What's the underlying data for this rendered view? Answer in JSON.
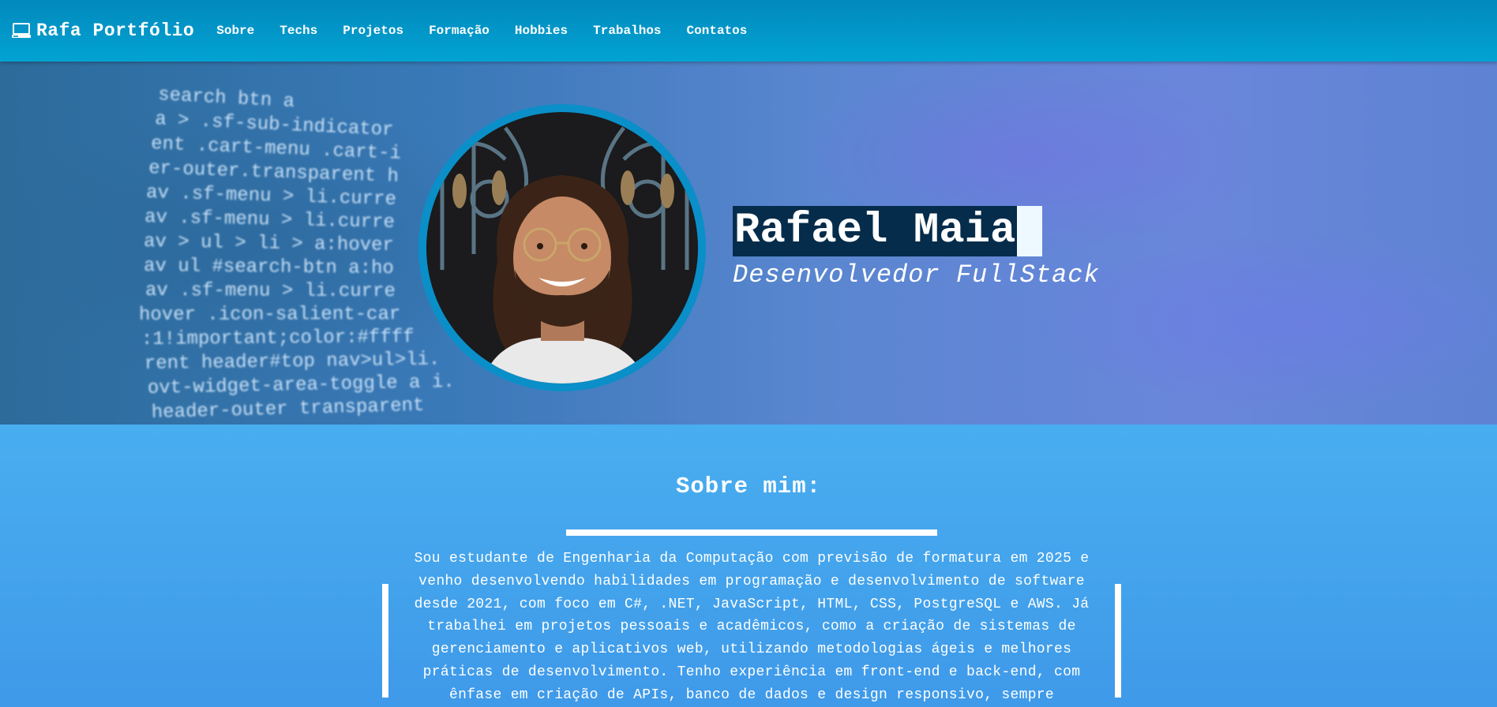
{
  "navbar": {
    "brand_icon": "laptop-icon",
    "brand": "Rafa Portfólio",
    "links": [
      "Sobre",
      "Techs",
      "Projetos",
      "Formação",
      "Hobbies",
      "Trabalhos",
      "Contatos"
    ]
  },
  "hero": {
    "name": "Rafael Maia",
    "role": "Desenvolvedor FullStack",
    "code_lines": [
      "search btn a",
      "a > .sf-sub-indicator",
      "ent .cart-menu .cart-i",
      "er-outer.transparent h",
      "av .sf-menu > li.curre",
      "av .sf-menu > li.curre",
      "av > ul > li > a:hover",
      "av ul #search-btn a:ho",
      "av .sf-menu > li.curre",
      "hover .icon-salient-car",
      ":1!important;color:#ffff",
      "rent header#top nav>ul>li.",
      "ovt-widget-area-toggle a i.",
      "header-outer transparent"
    ]
  },
  "about": {
    "title": "Sobre mim:",
    "text": "Sou estudante de Engenharia da Computação com previsão de formatura em 2025 e venho desenvolvendo habilidades em programação e desenvolvimento de software desde 2021, com foco em C#, .NET, JavaScript, HTML, CSS, PostgreSQL e AWS. Já trabalhei em projetos pessoais e acadêmicos, como a criação de sistemas de gerenciamento e aplicativos web, utilizando metodologias ágeis e melhores práticas de desenvolvimento. Tenho experiência em front-end e back-end, com ênfase em criação de APIs, banco de dados e design responsivo, sempre"
  },
  "colors": {
    "navbar": "#01a3d2",
    "name_highlight": "#052c4a",
    "avatar_ring": "#0a8fc8",
    "about_bg": "#3f9ae9"
  }
}
